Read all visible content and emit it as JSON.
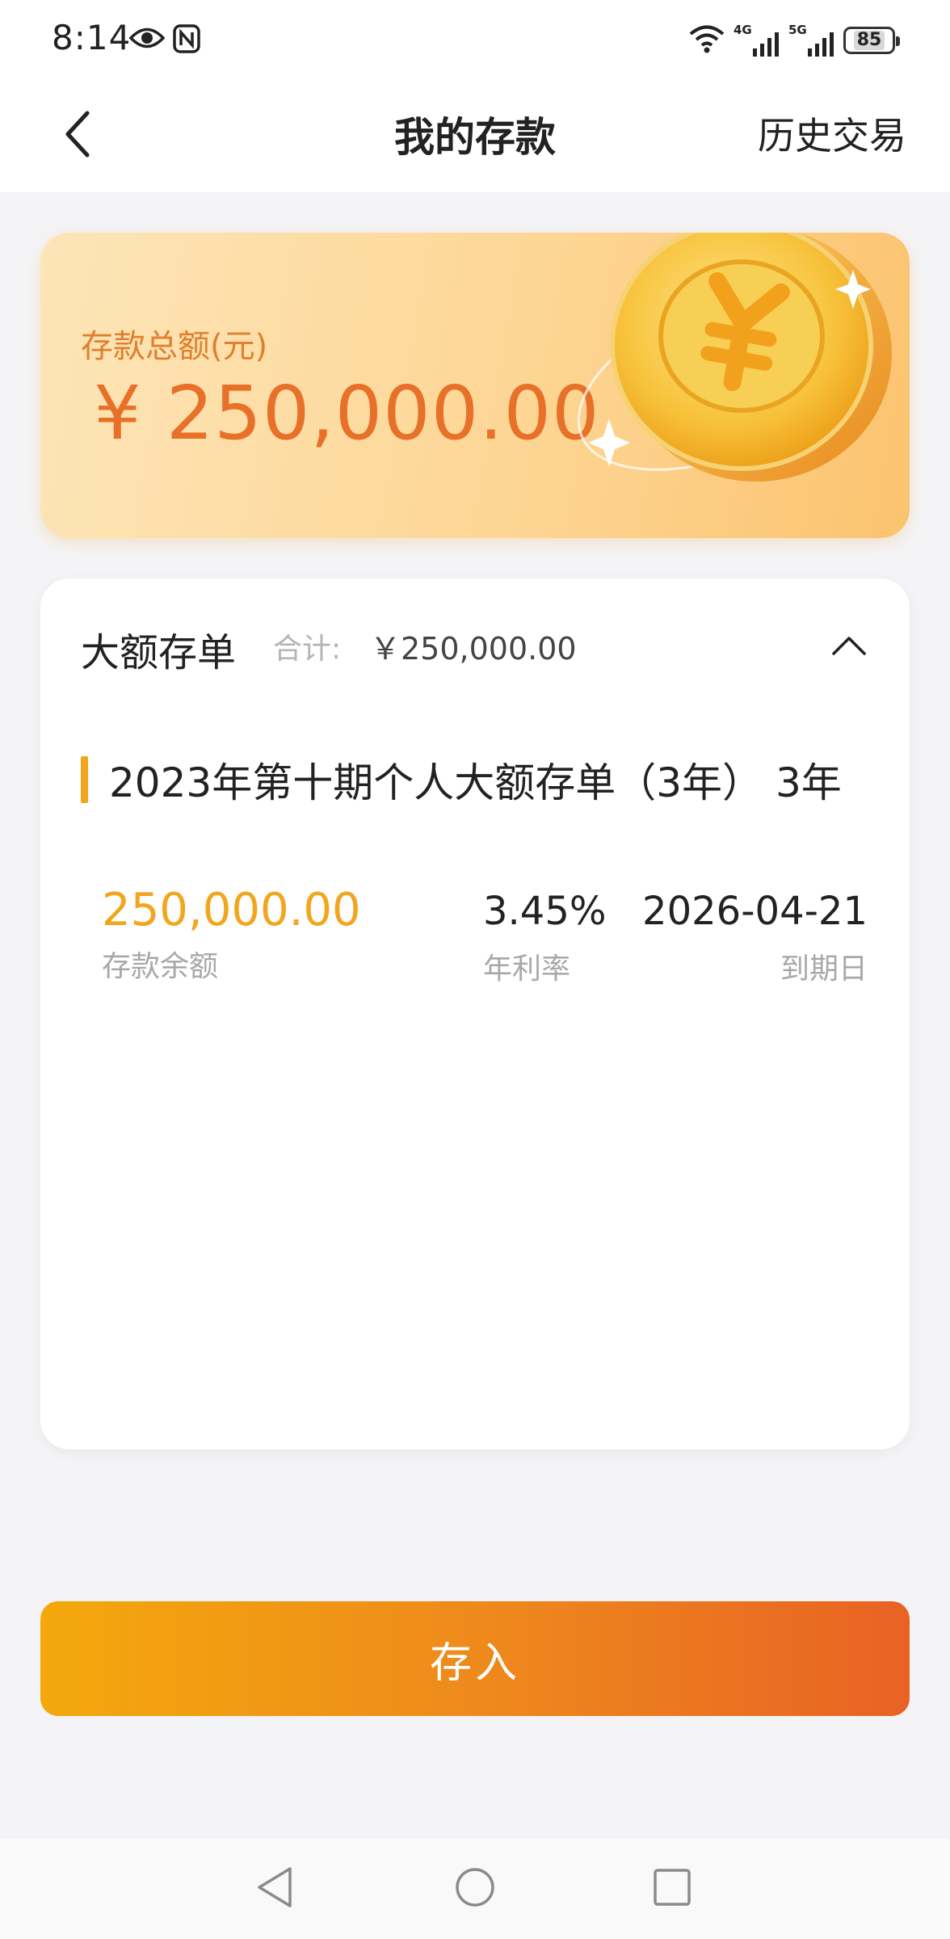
{
  "status_bar": {
    "time": "8:14",
    "signal_1_tag": "4G",
    "signal_2_tag": "5G",
    "battery": "85",
    "icons": [
      "eye-icon",
      "nfc-icon",
      "wifi-icon",
      "signal-icon",
      "battery-icon"
    ]
  },
  "header": {
    "back_icon": "chevron-left-icon",
    "title": "我的存款",
    "history_link": "历史交易"
  },
  "summary": {
    "label": "存款总额(元)",
    "amount": "¥ 250,000.00"
  },
  "deposit_group": {
    "type_name": "大额存单",
    "total_label": "合计:",
    "total_value": "￥250,000.00",
    "collapse_icon": "chevron-up-icon",
    "product": {
      "name": "2023年第十期个人大额存单（3年） 3年",
      "balance_value": "250,000.00",
      "balance_label": "存款余额",
      "rate_value": "3.45%",
      "rate_label": "年利率",
      "due_value": "2026-04-21",
      "due_label": "到期日"
    }
  },
  "action": {
    "deposit_button": "存入"
  },
  "colors": {
    "accent_orange": "#e8712a",
    "accent_yellow": "#f2a61e",
    "button_start": "#f4a80c",
    "button_end": "#e96224"
  }
}
